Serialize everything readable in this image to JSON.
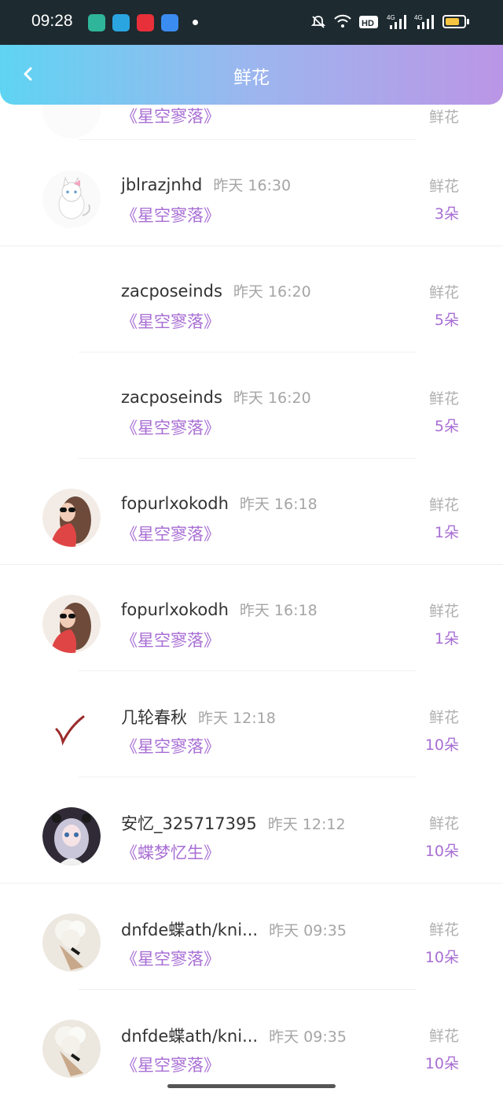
{
  "status": {
    "time": "09:28",
    "colors": {
      "bar": "#1d2a30",
      "battery": "#f5c542"
    },
    "icons": [
      "mute-icon",
      "wifi-icon",
      "hd-icon",
      "signal-4g-icon",
      "signal-4g-icon",
      "battery-icon"
    ]
  },
  "header": {
    "title": "鲜花",
    "back_icon": "chevron-left-icon"
  },
  "partial_row": {
    "book": "《星空寥落》",
    "gift_label": "鲜花"
  },
  "rows": [
    {
      "user": "jblrazjnhd",
      "time": "昨天 16:30",
      "book": "《星空寥落》",
      "gift_label": "鲜花",
      "count": "3朵",
      "avatar": "cat-avatar"
    },
    {
      "user": "zacposeinds",
      "time": "昨天 16:20",
      "book": "《星空寥落》",
      "gift_label": "鲜花",
      "count": "5朵",
      "avatar": "blank-avatar"
    },
    {
      "user": "zacposeinds",
      "time": "昨天 16:20",
      "book": "《星空寥落》",
      "gift_label": "鲜花",
      "count": "5朵",
      "avatar": "blank-avatar"
    },
    {
      "user": "fopurlxokodh",
      "time": "昨天 16:18",
      "book": "《星空寥落》",
      "gift_label": "鲜花",
      "count": "1朵",
      "avatar": "girl-avatar"
    },
    {
      "user": "fopurlxokodh",
      "time": "昨天 16:18",
      "book": "《星空寥落》",
      "gift_label": "鲜花",
      "count": "1朵",
      "avatar": "girl-avatar"
    },
    {
      "user": "几轮春秋",
      "time": "昨天 12:18",
      "book": "《星空寥落》",
      "gift_label": "鲜花",
      "count": "10朵",
      "avatar": "check-avatar"
    },
    {
      "user": "安忆_325717395",
      "time": "昨天 12:12",
      "book": "《蝶梦忆生》",
      "gift_label": "鲜花",
      "count": "10朵",
      "avatar": "anime-avatar"
    },
    {
      "user": "dnfde蝶ath/kni...",
      "time": "昨天 09:35",
      "book": "《星空寥落》",
      "gift_label": "鲜花",
      "count": "10朵",
      "avatar": "bouquet-avatar"
    },
    {
      "user": "dnfde蝶ath/kni...",
      "time": "昨天 09:35",
      "book": "《星空寥落》",
      "gift_label": "鲜花",
      "count": "10朵",
      "avatar": "bouquet-avatar"
    }
  ],
  "colors": {
    "accent": "#a86ed4",
    "muted": "#a5a5a5",
    "header_start": "#5fd4f2",
    "header_end": "#bb96e6"
  }
}
